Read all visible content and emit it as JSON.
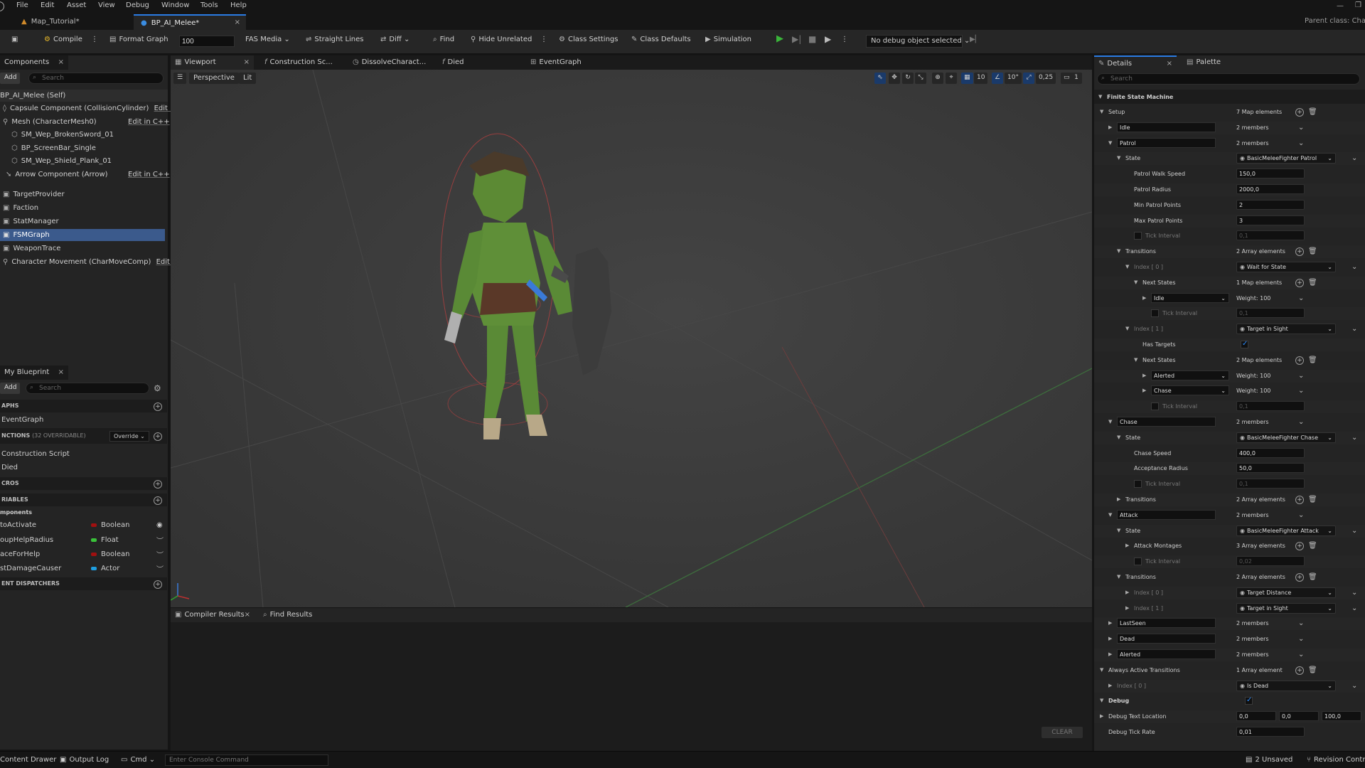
{
  "colors": {
    "accent": "#2a7be4",
    "selection": "#3b5a8c",
    "boolean": "#a01010",
    "float": "#3ac23a",
    "actor": "#1e9ee0",
    "play": "#3ab53a"
  },
  "menu": [
    "File",
    "Edit",
    "Asset",
    "View",
    "Debug",
    "Window",
    "Tools",
    "Help"
  ],
  "tabs": [
    {
      "label": "Map_Tutorial*"
    },
    {
      "label": "BP_AI_Melee*"
    }
  ],
  "parent_class": "Parent class: Cha",
  "toolbar": {
    "compile": "Compile",
    "format_graph": "Format Graph",
    "zoom_value": "100",
    "fas_media": "FAS Media",
    "straight_lines": "Straight Lines",
    "diff": "Diff",
    "find": "Find",
    "hide_unrelated": "Hide Unrelated",
    "class_settings": "Class Settings",
    "class_defaults": "Class Defaults",
    "simulation": "Simulation",
    "debug_object": "No debug object selected"
  },
  "components": {
    "title": "Components",
    "add": "Add",
    "search": "Search",
    "items": [
      {
        "label": "BP_AI_Melee (Self)",
        "edit": ""
      },
      {
        "label": "Capsule Component (CollisionCylinder)",
        "edit": "Edit in"
      },
      {
        "label": "Mesh (CharacterMesh0)",
        "edit": "Edit in C++"
      },
      {
        "label": "SM_Wep_BrokenSword_01",
        "edit": ""
      },
      {
        "label": "BP_ScreenBar_Single",
        "edit": ""
      },
      {
        "label": "SM_Wep_Shield_Plank_01",
        "edit": ""
      },
      {
        "label": "Arrow Component (Arrow)",
        "edit": "Edit in C++"
      },
      {
        "label": "TargetProvider",
        "edit": ""
      },
      {
        "label": "Faction",
        "edit": ""
      },
      {
        "label": "StatManager",
        "edit": ""
      },
      {
        "label": "FSMGraph",
        "edit": ""
      },
      {
        "label": "WeaponTrace",
        "edit": ""
      },
      {
        "label": "Character Movement (CharMoveComp)",
        "edit": "Edit in"
      }
    ]
  },
  "my_blueprint": {
    "title": "My Blueprint",
    "add": "Add",
    "search": "Search",
    "graphs_header": "APHS",
    "event_graph": "EventGraph",
    "functions_header": "NCTIONS",
    "functions_count": "(32 OVERRIDABLE)",
    "override": "Override",
    "functions": [
      "Construction Script",
      "Died"
    ],
    "macros_header": "CROS",
    "variables_header": "RIABLES",
    "components_header": "mponents",
    "variables": [
      {
        "name": "toActivate",
        "type": "Boolean"
      },
      {
        "name": "oupHelpRadius",
        "type": "Float"
      },
      {
        "name": "aceForHelp",
        "type": "Boolean"
      },
      {
        "name": "stDamageCauser",
        "type": "Actor"
      }
    ],
    "dispatchers_header": "ENT DISPATCHERS"
  },
  "editor_tabs": [
    "Viewport",
    "Construction Sc...",
    "DissolveCharact...",
    "Died",
    "EventGraph"
  ],
  "viewport": {
    "perspective": "Perspective",
    "lit": "Lit",
    "grid": "10",
    "angle": "10°",
    "scale": "0,25",
    "cam": "1"
  },
  "bottom": {
    "compiler_results": "Compiler Results",
    "find_results": "Find Results",
    "clear": "CLEAR"
  },
  "details": {
    "title": "Details",
    "palette": "Palette",
    "search": "Search",
    "fsm": "Finite State Machine",
    "rows": [
      {
        "i": 0,
        "l": "Setup",
        "v": "7 Map elements",
        "e": "open",
        "btns": true
      },
      {
        "i": 1,
        "l": "Idle",
        "v": "2 members",
        "e": "closed",
        "key": true,
        "combo": true
      },
      {
        "i": 1,
        "l": "Patrol",
        "v": "2 members",
        "e": "open",
        "key": true,
        "combo": true
      },
      {
        "i": 2,
        "l": "State",
        "v": "BasicMeleeFighter Patrol",
        "e": "open",
        "asset": true
      },
      {
        "i": 3,
        "l": "Patrol Walk Speed",
        "v": "150,0",
        "fld": true
      },
      {
        "i": 3,
        "l": "Patrol Radius",
        "v": "2000,0",
        "fld": true
      },
      {
        "i": 3,
        "l": "Min Patrol Points",
        "v": "2",
        "fld": true
      },
      {
        "i": 3,
        "l": "Max Patrol Points",
        "v": "3",
        "fld": true
      },
      {
        "i": 3,
        "l": "Tick Interval",
        "v": "0,1",
        "fld": true,
        "dim": true,
        "cb": true
      },
      {
        "i": 2,
        "l": "Transitions",
        "v": "2 Array elements",
        "e": "open",
        "btns": true
      },
      {
        "i": 3,
        "l": "Index [ 0 ]",
        "v": "Wait for State",
        "e": "open",
        "asset": true,
        "dimlbl": true
      },
      {
        "i": 4,
        "l": "Next States",
        "v": "1 Map elements",
        "e": "open",
        "btns": true
      },
      {
        "i": 5,
        "l": "Idle",
        "v": "Weight: 100",
        "e": "closed",
        "key": true,
        "wcombo": true
      },
      {
        "i": 5,
        "l": "Tick Interval",
        "v": "0,1",
        "fld": true,
        "dim": true,
        "cb": true
      },
      {
        "i": 3,
        "l": "Index [ 1 ]",
        "v": "Target in Sight",
        "e": "open",
        "asset": true,
        "dimlbl": true
      },
      {
        "i": 4,
        "l": "Has Targets",
        "v": "",
        "check": true
      },
      {
        "i": 4,
        "l": "Next States",
        "v": "2 Map elements",
        "e": "open",
        "btns": true
      },
      {
        "i": 5,
        "l": "Alerted",
        "v": "Weight: 100",
        "e": "closed",
        "key": true,
        "wcombo": true
      },
      {
        "i": 5,
        "l": "Chase",
        "v": "Weight: 100",
        "e": "closed",
        "key": true,
        "wcombo": true
      },
      {
        "i": 5,
        "l": "Tick Interval",
        "v": "0,1",
        "fld": true,
        "dim": true,
        "cb": true
      },
      {
        "i": 1,
        "l": "Chase",
        "v": "2 members",
        "e": "open",
        "key": true,
        "combo": true
      },
      {
        "i": 2,
        "l": "State",
        "v": "BasicMeleeFighter Chase",
        "e": "open",
        "asset": true
      },
      {
        "i": 3,
        "l": "Chase Speed",
        "v": "400,0",
        "fld": true
      },
      {
        "i": 3,
        "l": "Acceptance Radius",
        "v": "50,0",
        "fld": true
      },
      {
        "i": 3,
        "l": "Tick Interval",
        "v": "0,1",
        "fld": true,
        "dim": true,
        "cb": true
      },
      {
        "i": 2,
        "l": "Transitions",
        "v": "2 Array elements",
        "e": "closed",
        "btns": true
      },
      {
        "i": 1,
        "l": "Attack",
        "v": "2 members",
        "e": "open",
        "key": true,
        "combo": true
      },
      {
        "i": 2,
        "l": "State",
        "v": "BasicMeleeFighter Attack",
        "e": "open",
        "asset": true
      },
      {
        "i": 3,
        "l": "Attack Montages",
        "v": "3 Array elements",
        "e": "closed",
        "btns": true
      },
      {
        "i": 3,
        "l": "Tick Interval",
        "v": "0,02",
        "fld": true,
        "dim": true,
        "cb": true
      },
      {
        "i": 2,
        "l": "Transitions",
        "v": "2 Array elements",
        "e": "open",
        "btns": true
      },
      {
        "i": 3,
        "l": "Index [ 0 ]",
        "v": "Target Distance",
        "e": "closed",
        "asset": true,
        "dimlbl": true
      },
      {
        "i": 3,
        "l": "Index [ 1 ]",
        "v": "Target in Sight",
        "e": "closed",
        "asset": true,
        "dimlbl": true
      },
      {
        "i": 1,
        "l": "LastSeen",
        "v": "2 members",
        "e": "closed",
        "key": true,
        "combo": true
      },
      {
        "i": 1,
        "l": "Dead",
        "v": "2 members",
        "e": "closed",
        "key": true,
        "combo": true
      },
      {
        "i": 1,
        "l": "Alerted",
        "v": "2 members",
        "e": "closed",
        "key": true,
        "combo": true
      },
      {
        "i": 0,
        "l": "Always Active Transitions",
        "v": "1 Array element",
        "e": "open",
        "btns": true
      },
      {
        "i": 1,
        "l": "Index [ 0 ]",
        "v": "Is Dead",
        "e": "closed",
        "asset": true,
        "dimlbl": true
      },
      {
        "i": 0,
        "l": "Debug",
        "v": "",
        "e": "open",
        "check": true,
        "header": true
      },
      {
        "i": 0,
        "l": "Debug Text Location",
        "v": "0,0",
        "v2": "0,0",
        "v3": "100,0",
        "e": "closed",
        "vec": true
      },
      {
        "i": 0,
        "l": "Debug Tick Rate",
        "v": "0,01",
        "fld": true
      }
    ]
  },
  "status": {
    "content_drawer": "Content Drawer",
    "output_log": "Output Log",
    "cmd": "Cmd",
    "console": "Enter Console Command",
    "unsaved": "2 Unsaved",
    "revision": "Revision Contr"
  }
}
